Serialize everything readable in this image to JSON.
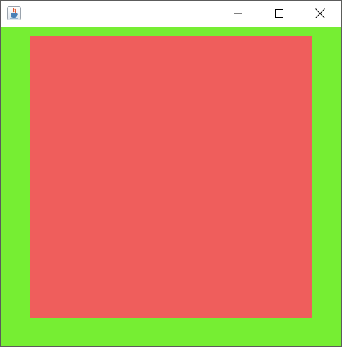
{
  "window": {
    "app_icon": "java-cup-icon",
    "controls": [
      "minimize-icon",
      "maximize-icon",
      "close-icon"
    ]
  },
  "canvas": {
    "background_color": "#76ee33",
    "square_color": "#ef5e5c"
  }
}
